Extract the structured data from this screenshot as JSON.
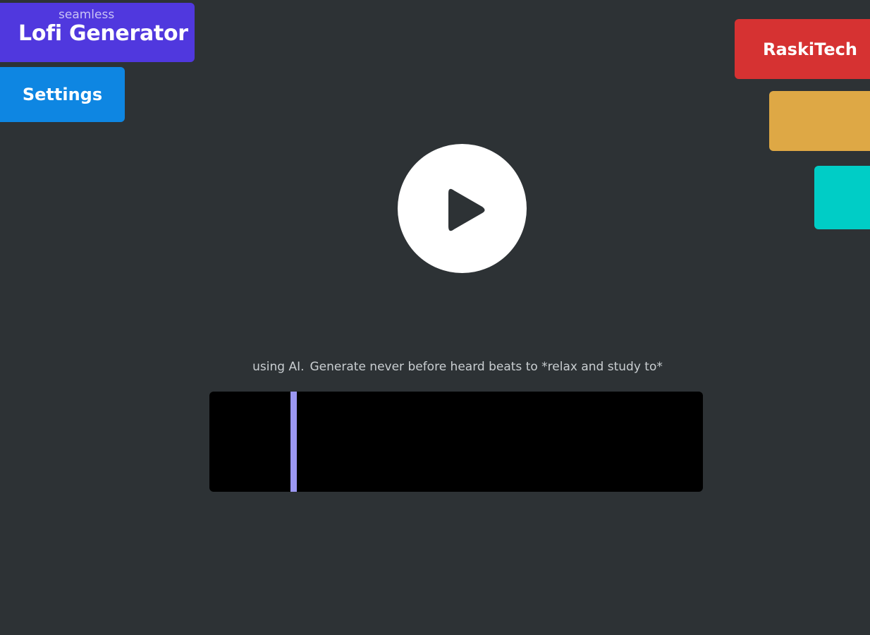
{
  "app": {
    "title_small": "seamless",
    "title_main": "Lofi Generator",
    "title_color": "#5038de"
  },
  "nav": {
    "settings_label": "Settings",
    "settings_color": "#0e86e2"
  },
  "side_tabs": [
    {
      "label": "RaskiTech",
      "color": "#d63232"
    },
    {
      "label": "",
      "color": "#dea845"
    },
    {
      "label": "",
      "color": "#00cdc6"
    }
  ],
  "player": {
    "play_icon": "play-icon",
    "tagline_part1": "using AI.",
    "tagline_part2": "Generate never before heard beats to *relax and study to*"
  },
  "visualizer": {
    "bar_color": "#9b97f2",
    "background": "#000000"
  }
}
